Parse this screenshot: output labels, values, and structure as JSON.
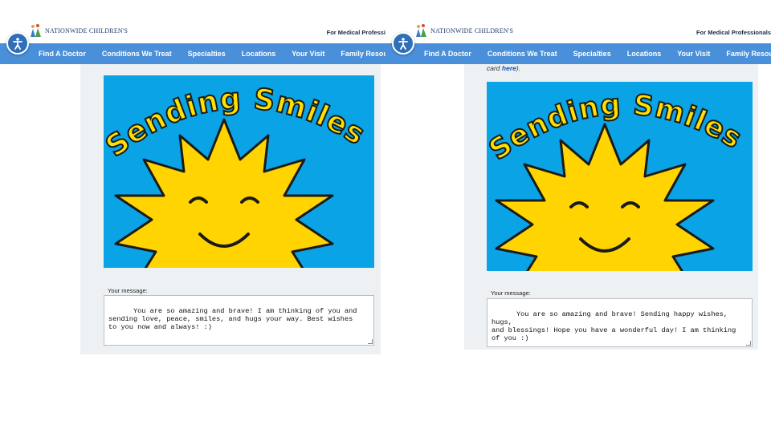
{
  "header": {
    "logo_text": "NATIONWIDE CHILDREN'S",
    "pro_link": "For Medical Professi",
    "pro_link_right": "For Medical Professionals"
  },
  "nav": {
    "items": [
      "Find A Doctor",
      "Conditions We Treat",
      "Specialties",
      "Locations",
      "Your Visit",
      "Family Resource"
    ],
    "items_right": [
      "Find A Doctor",
      "Conditions We Treat",
      "Specialties",
      "Locations",
      "Your Visit",
      "Family Resources"
    ]
  },
  "card": {
    "banner": "Sending Smiles!",
    "hint_prefix": "card ",
    "hint_link": "here",
    "hint_suffix": ")."
  },
  "left_pane": {
    "message_label": "Your message:",
    "message": "You are so amazing and brave! I am thinking of you and\nsending love, peace, smiles, and hugs your way. Best wishes\nto you now and always! :)"
  },
  "right_pane": {
    "message_label": "Your message:",
    "message": "You are so amazing and brave! Sending happy wishes, hugs,\nand blessings! Hope you have a wonderful day! I am thinking\nof you :)"
  },
  "colors": {
    "nav_bg": "#4a8fd9",
    "card_bg": "#0aa3e6",
    "sun": "#ffd400",
    "banner_text": "#ffe000"
  }
}
